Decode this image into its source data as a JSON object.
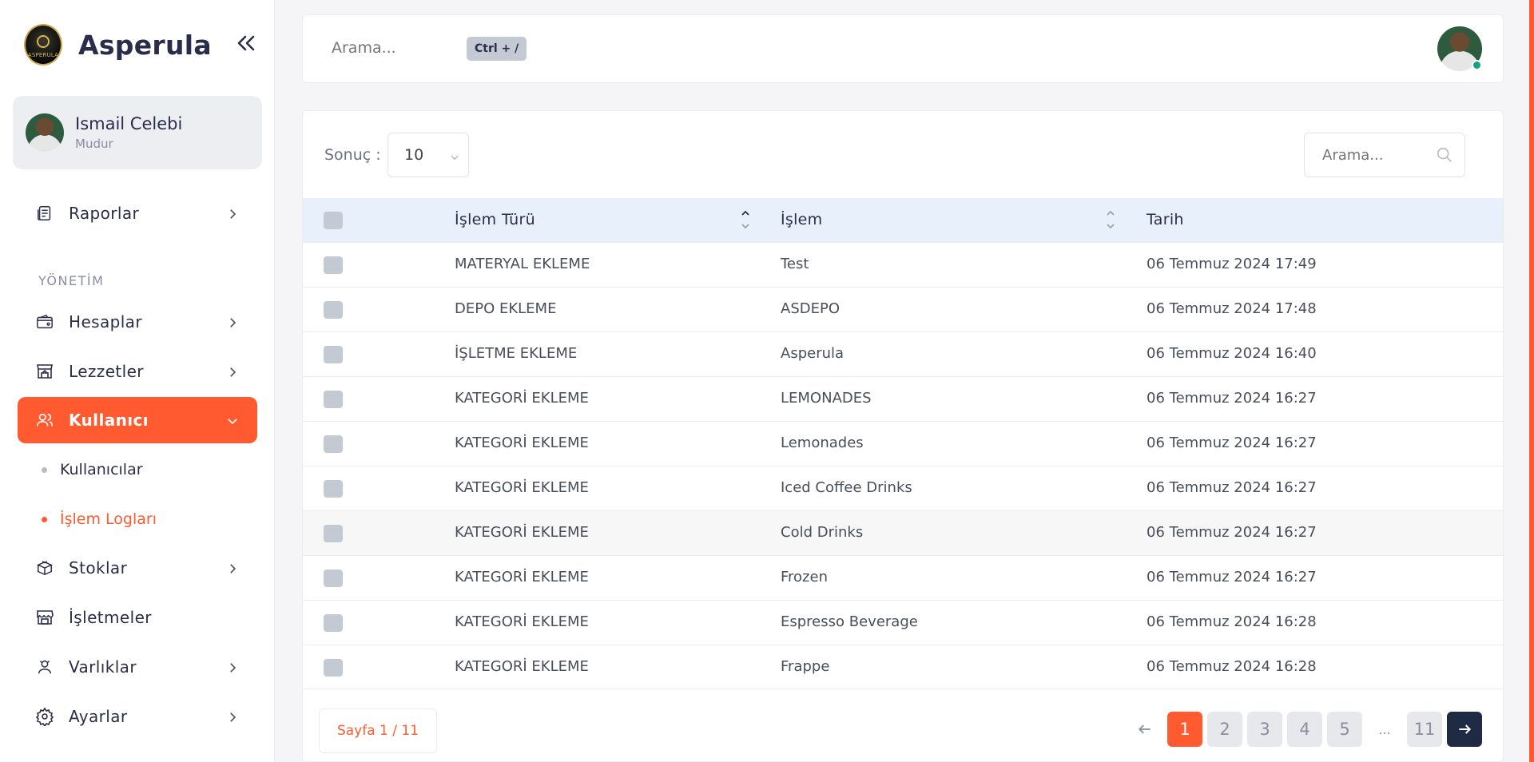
{
  "sidebar": {
    "brand": "Asperula",
    "logo_text": "ASPERULA",
    "user": {
      "name": "Ismail Celebi",
      "role": "Mudur"
    },
    "items": [
      {
        "label": "Raporlar"
      },
      {
        "label": "Hesaplar"
      },
      {
        "label": "Lezzetler"
      },
      {
        "label": "Kullanıcı"
      },
      {
        "label": "Stoklar"
      },
      {
        "label": "İşletmeler"
      },
      {
        "label": "Varlıklar"
      },
      {
        "label": "Ayarlar"
      }
    ],
    "section": "YÖNETİM",
    "sub_items": [
      {
        "label": "Kullanıcılar"
      },
      {
        "label": "İşlem Logları"
      }
    ]
  },
  "topbar": {
    "search_placeholder": "Arama...",
    "shortcut": "Ctrl + /"
  },
  "table": {
    "results_label": "Sonuç :",
    "page_size": "10",
    "search_placeholder": "Arama...",
    "columns": [
      "İşlem Türü",
      "İşlem",
      "Tarih"
    ],
    "rows": [
      [
        "MATERYAL EKLEME",
        "Test",
        "06 Temmuz 2024 17:49"
      ],
      [
        "DEPO EKLEME",
        "ASDEPO",
        "06 Temmuz 2024 17:48"
      ],
      [
        "İŞLETME EKLEME",
        "Asperula",
        "06 Temmuz 2024 16:40"
      ],
      [
        "KATEGORİ EKLEME",
        "LEMONADES",
        "06 Temmuz 2024 16:27"
      ],
      [
        "KATEGORİ EKLEME",
        "Lemonades",
        "06 Temmuz 2024 16:27"
      ],
      [
        "KATEGORİ EKLEME",
        "Iced Coffee Drinks",
        "06 Temmuz 2024 16:27"
      ],
      [
        "KATEGORİ EKLEME",
        "Cold Drinks",
        "06 Temmuz 2024 16:27"
      ],
      [
        "KATEGORİ EKLEME",
        "Frozen",
        "06 Temmuz 2024 16:27"
      ],
      [
        "KATEGORİ EKLEME",
        "Espresso Beverage",
        "06 Temmuz 2024 16:28"
      ],
      [
        "KATEGORİ EKLEME",
        "Frappe",
        "06 Temmuz 2024 16:28"
      ]
    ]
  },
  "pagination": {
    "info": "Sayfa 1 / 11",
    "pages": [
      "1",
      "2",
      "3",
      "4",
      "5",
      "...",
      "11"
    ],
    "prev_icon": "arrow-left-icon",
    "next_icon": "arrow-right-icon"
  },
  "colors": {
    "accent": "#ff5a30",
    "dark": "#1f2a44",
    "header_bg": "#e8f1fb"
  }
}
